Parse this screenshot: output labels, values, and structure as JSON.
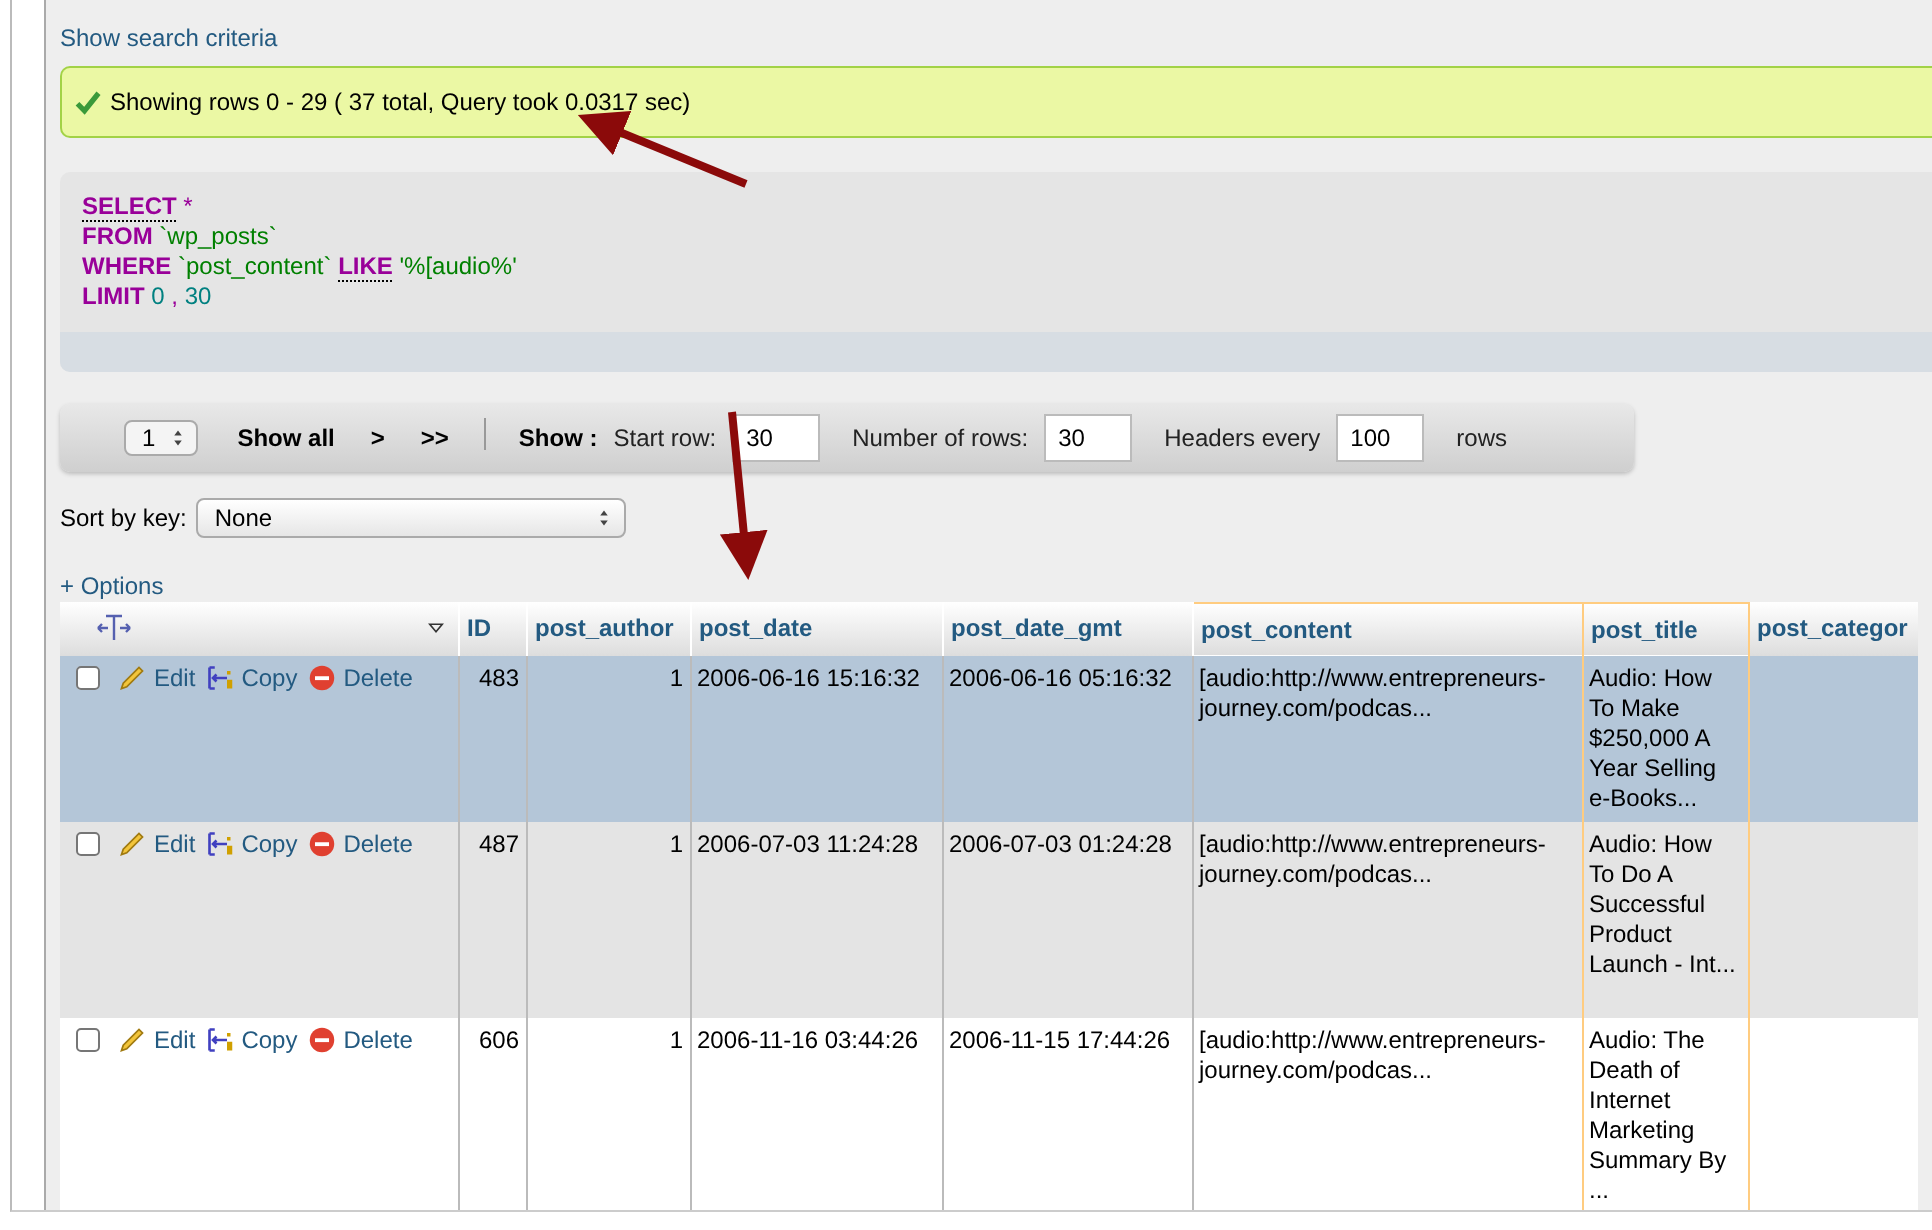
{
  "search_criteria_link": "Show search criteria",
  "message": {
    "text": "Showing rows 0 - 29 ( 37 total, Query took 0.0317 sec)"
  },
  "sql": [
    [
      {
        "kind": "keyword_link",
        "text": "SELECT"
      },
      {
        "kind": "op",
        "text": " *"
      }
    ],
    [
      {
        "kind": "keyword",
        "text": "FROM"
      },
      {
        "kind": "ident",
        "text": " `wp_posts`"
      }
    ],
    [
      {
        "kind": "keyword",
        "text": "WHERE"
      },
      {
        "kind": "ident",
        "text": " `post_content` "
      },
      {
        "kind": "keyword_link",
        "text": "LIKE"
      },
      {
        "kind": "ident",
        "text": " '%[audio%'"
      }
    ],
    [
      {
        "kind": "keyword",
        "text": "LIMIT"
      },
      {
        "kind": "number",
        "text": " 0"
      },
      {
        "kind": "op",
        "text": " ,"
      },
      {
        "kind": "number",
        "text": " 30"
      }
    ]
  ],
  "navigation": {
    "page": "1",
    "show_all": "Show all",
    "next": ">",
    "last": ">>",
    "show_label": "Show :",
    "start_row_label": "Start row:",
    "start_row": "30",
    "rows_label": "Number of rows:",
    "rows": "30",
    "headers_label": "Headers every",
    "headers": "100",
    "rows_suffix": "rows"
  },
  "sort": {
    "label": "Sort by key:",
    "value": "None"
  },
  "options_link": "+ Options",
  "table": {
    "columns": [
      {
        "label": "ID",
        "highlighted": false
      },
      {
        "label": "post_author",
        "highlighted": false
      },
      {
        "label": "post_date",
        "highlighted": false
      },
      {
        "label": "post_date_gmt",
        "highlighted": false
      },
      {
        "label": "post_content",
        "highlighted": true
      },
      {
        "label": "post_title",
        "highlighted": true
      },
      {
        "label": "post_categor",
        "highlighted": false
      }
    ],
    "rows": [
      {
        "selected": true,
        "checked": false,
        "edit": "Edit",
        "copy": "Copy",
        "delete": "Delete",
        "cells": [
          "483",
          "1",
          "2006-06-16 15:16:32",
          "2006-06-16 05:16:32",
          "[audio:http://www.entrepreneurs-journey.com/podcas...",
          "Audio: How To Make $250,000 A Year Selling e-Books...",
          ""
        ]
      },
      {
        "selected": false,
        "checked": false,
        "edit": "Edit",
        "copy": "Copy",
        "delete": "Delete",
        "cells": [
          "487",
          "1",
          "2006-07-03 11:24:28",
          "2006-07-03 01:24:28",
          "[audio:http://www.entrepreneurs-journey.com/podcas...",
          "Audio: How To Do A Successful Product Launch - Int...",
          ""
        ]
      },
      {
        "selected": false,
        "checked": false,
        "edit": "Edit",
        "copy": "Copy",
        "delete": "Delete",
        "cells": [
          "606",
          "1",
          "2006-11-16 03:44:26",
          "2006-11-15 17:44:26",
          "[audio:http://www.entrepreneurs-journey.com/podcas...",
          "Audio: The Death of Internet Marketing Summary By ...",
          ""
        ]
      }
    ]
  }
}
